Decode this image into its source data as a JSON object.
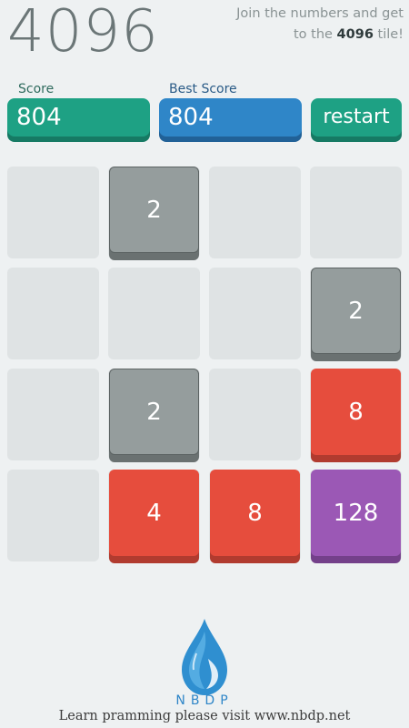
{
  "game": {
    "title": "4096",
    "tagline_prefix": "Join the numbers and get to the ",
    "tagline_highlight": "4096",
    "tagline_suffix": " tile!"
  },
  "scoreboard": {
    "score_label": "Score",
    "score_value": "804",
    "best_label": "Best Score",
    "best_value": "804",
    "restart_label": "restart"
  },
  "board": {
    "size": 4,
    "rows": [
      [
        "",
        "2",
        "",
        ""
      ],
      [
        "",
        "",
        "",
        "2"
      ],
      [
        "",
        "2",
        "",
        "8"
      ],
      [
        "",
        "4",
        "8",
        "128"
      ]
    ]
  },
  "footer": {
    "brand": "NBDP",
    "text": "Learn pramming please visit www.nbdp.net"
  },
  "colors": {
    "background": "#eef1f2",
    "score_box": "#1ea184",
    "best_box": "#2f86c8",
    "tile_2": "#959d9d",
    "tile_4": "#e64d3d",
    "tile_8": "#e64d3d",
    "tile_128": "#9b58b5"
  }
}
